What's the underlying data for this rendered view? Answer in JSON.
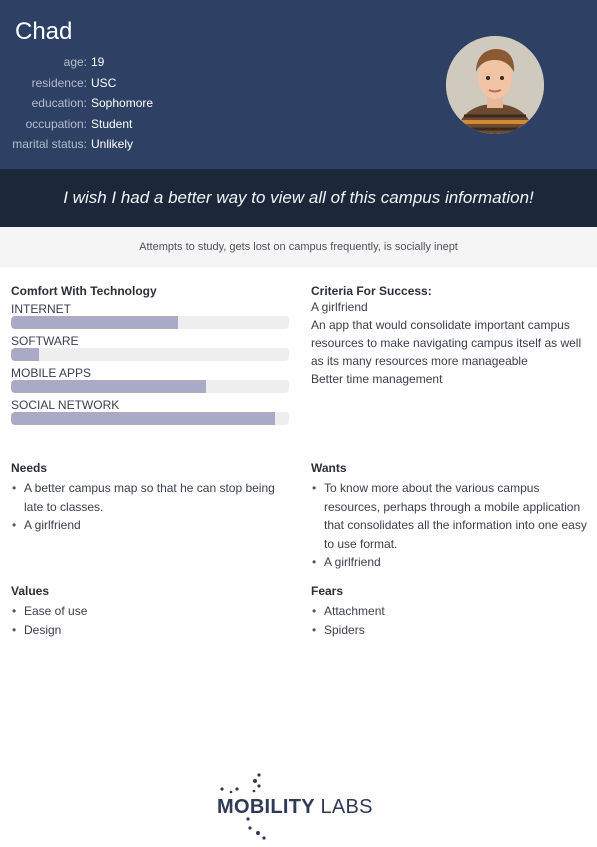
{
  "persona": {
    "name": "Chad",
    "details": [
      {
        "key": "age:",
        "value": "19"
      },
      {
        "key": "residence:",
        "value": "USC"
      },
      {
        "key": "education:",
        "value": "Sophomore"
      },
      {
        "key": "occupation:",
        "value": "Student"
      },
      {
        "key": "marital status:",
        "value": "Unlikely"
      }
    ]
  },
  "quote": "I wish I had a better way to view all of this campus information!",
  "summary": "Attempts to study, gets lost on campus frequently, is socially inept",
  "technology": {
    "title": "Comfort With Technology",
    "items": [
      {
        "label": "INTERNET",
        "level": 0.6
      },
      {
        "label": "SOFTWARE",
        "level": 0.1
      },
      {
        "label": "MOBILE APPS",
        "level": 0.7
      },
      {
        "label": "SOCIAL NETWORK",
        "level": 0.95
      }
    ],
    "fill_color": "#abaac6",
    "track_color": "#eeeeef"
  },
  "criteria": {
    "title": "Criteria For Success:",
    "lines": [
      "A girlfriend",
      "An app that would consolidate important campus resources to make navigating campus itself as well as its many resources more manageable",
      "Better time management"
    ]
  },
  "needs": {
    "title": "Needs",
    "items": [
      "A better campus map so that he can stop being late to classes.",
      "A girlfriend"
    ]
  },
  "wants": {
    "title": "Wants",
    "items": [
      "To know more about the various campus resources, perhaps through a mobile application that consolidates all the information into one easy to use format.",
      "A girlfriend"
    ]
  },
  "values": {
    "title": "Values",
    "items": [
      "Ease of use",
      "Design"
    ]
  },
  "fears": {
    "title": "Fears",
    "items": [
      "Attachment",
      "Spiders"
    ]
  },
  "logo": {
    "brand_bold": "MOBILITY",
    "brand_light": "LABS"
  },
  "colors": {
    "header_bg": "#2e4164",
    "quote_bg": "#1c2739",
    "summary_bg": "#f5f5f5"
  },
  "icons": {
    "avatar": "user-photo",
    "logo_mark": "dot-cluster-logo"
  }
}
